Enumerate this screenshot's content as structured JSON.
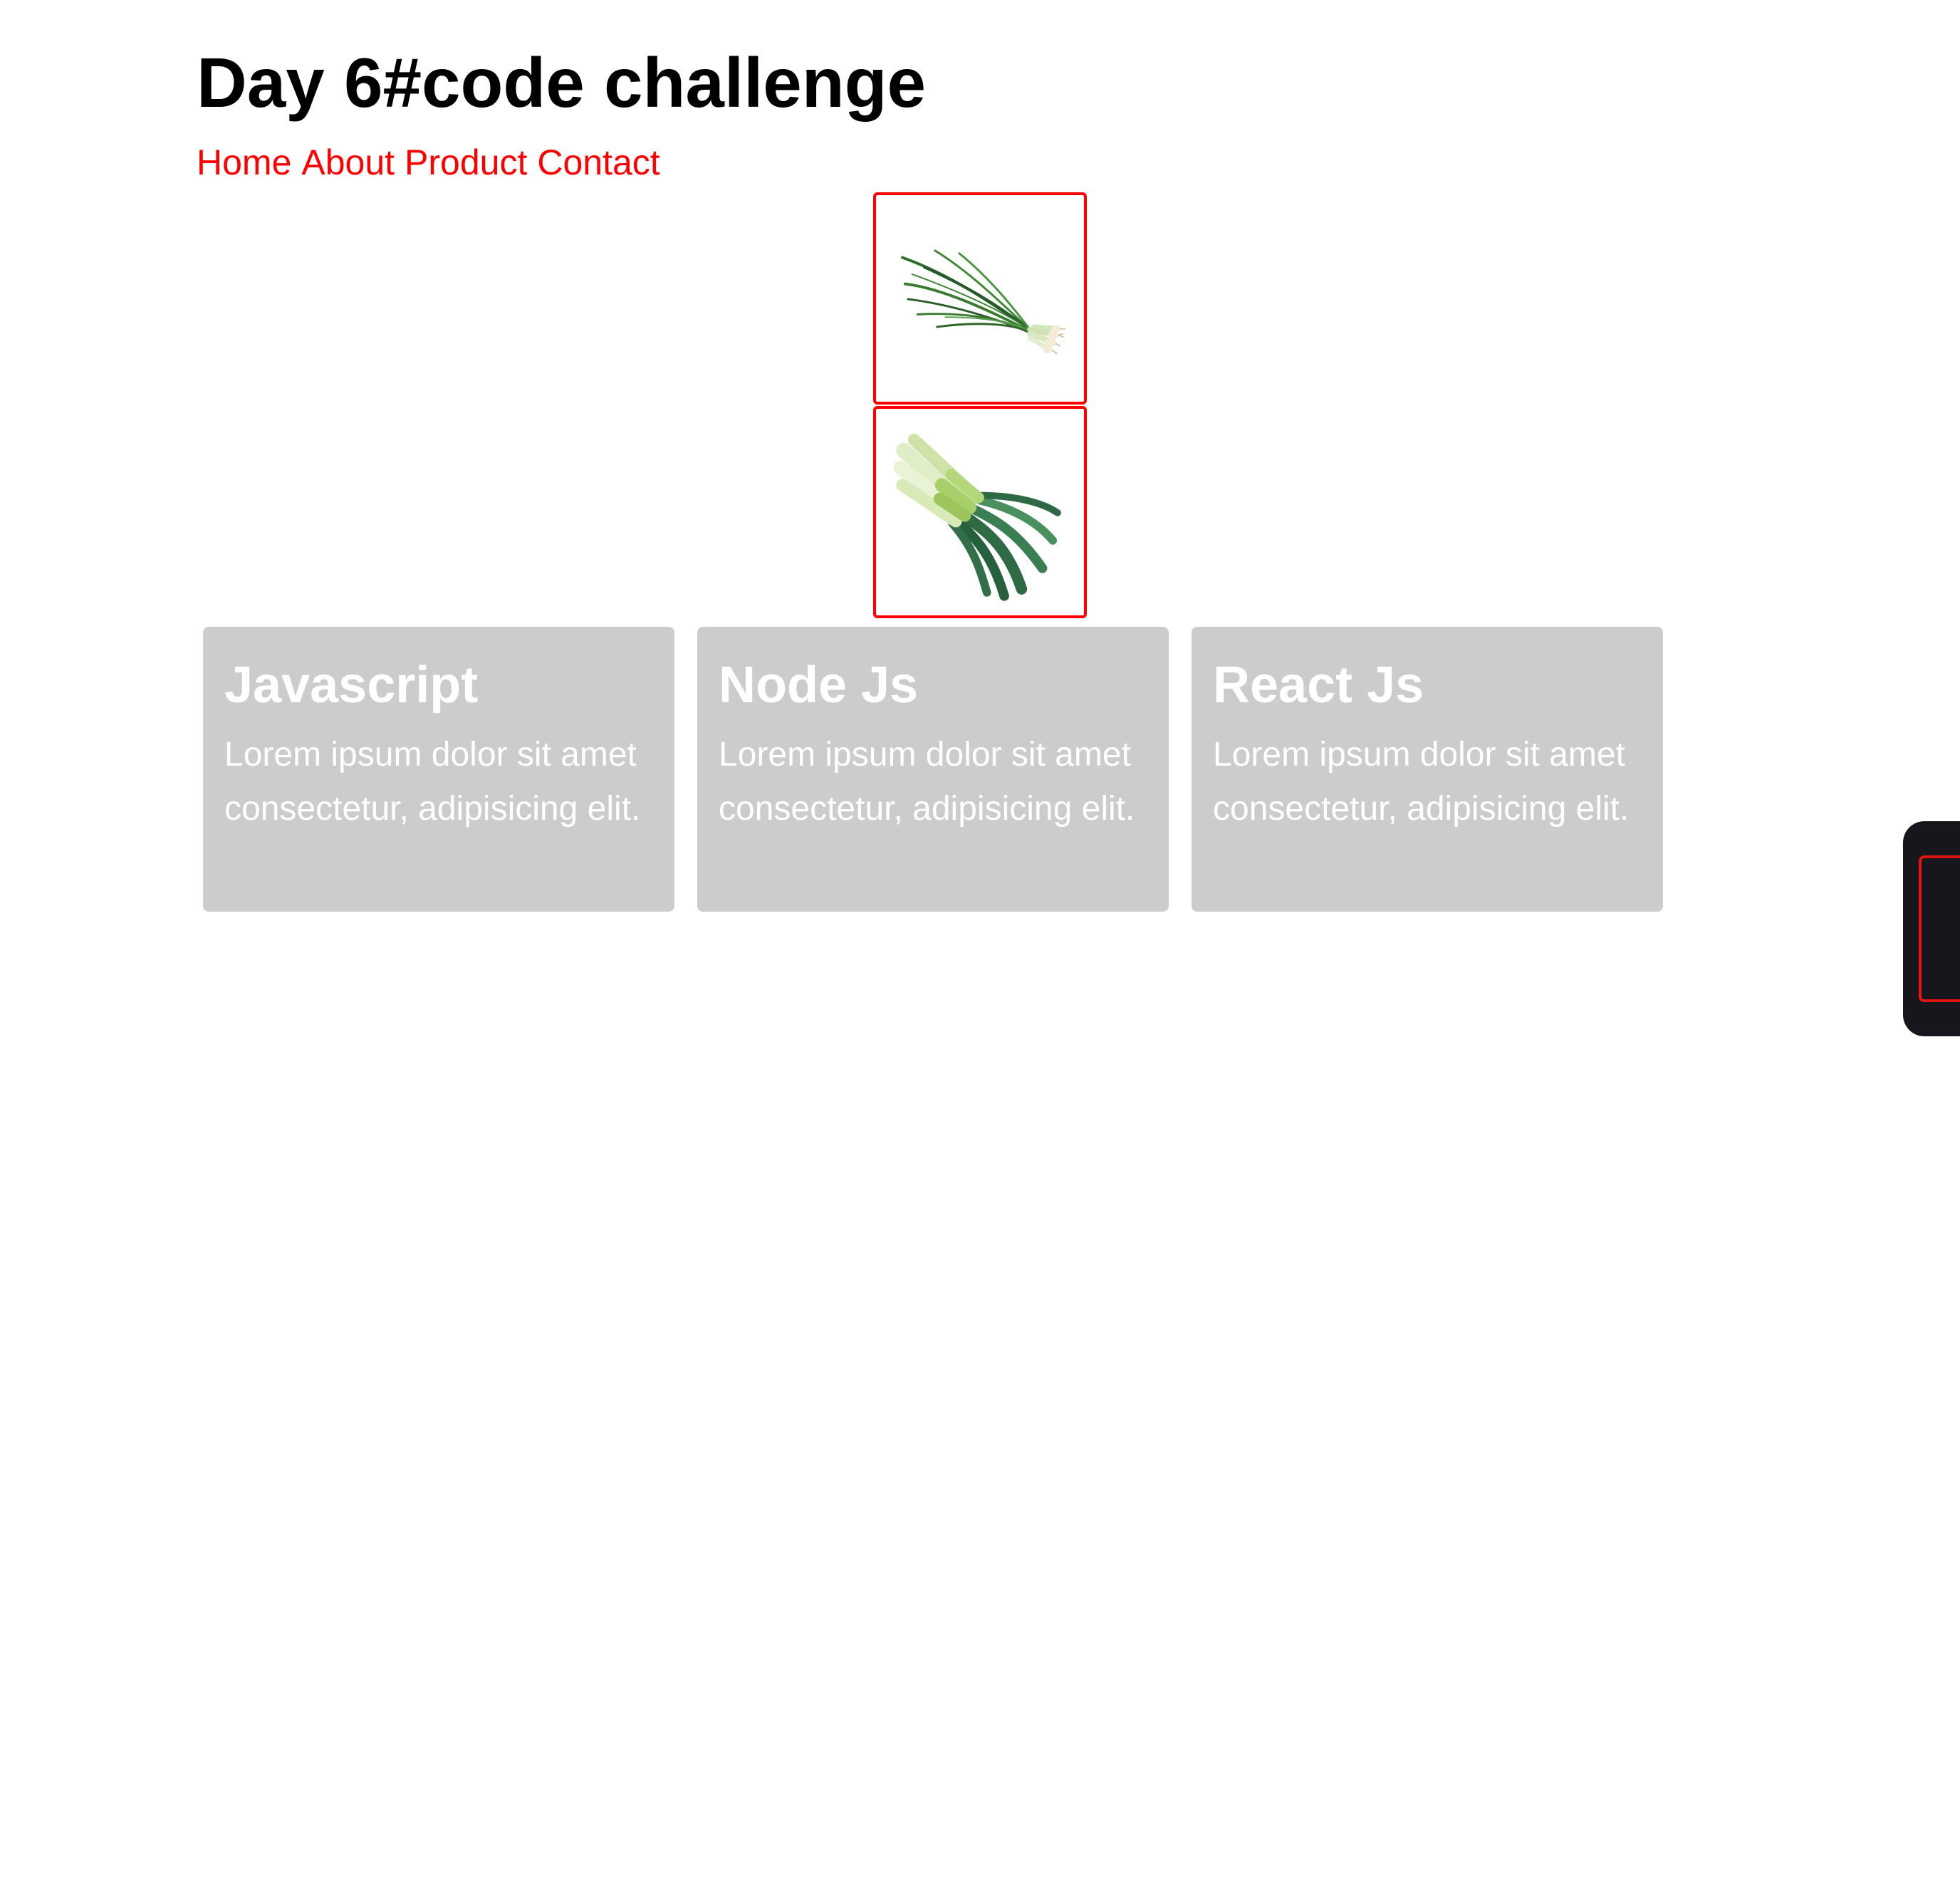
{
  "page": {
    "title": "Day 6#code challenge"
  },
  "nav": {
    "items": [
      {
        "label": "Home"
      },
      {
        "label": "About"
      },
      {
        "label": "Product"
      },
      {
        "label": "Contact"
      }
    ],
    "color": "#ff0000"
  },
  "images": [
    {
      "icon": "spring-onion-image"
    },
    {
      "icon": "leek-image"
    }
  ],
  "cards": [
    {
      "title": "Javascript",
      "text": "Lorem ipsum dolor sit amet consectetur, adipisicing elit."
    },
    {
      "title": "Node Js",
      "text": "Lorem ipsum dolor sit amet consectetur, adipisicing elit."
    },
    {
      "title": "React Js",
      "text": "Lorem ipsum dolor sit amet consectetur, adipisicing elit."
    }
  ],
  "colors": {
    "accent": "#ff0000",
    "card_background": "#cccccc",
    "card_text": "#ffffff",
    "widget_background": "#16161c"
  }
}
